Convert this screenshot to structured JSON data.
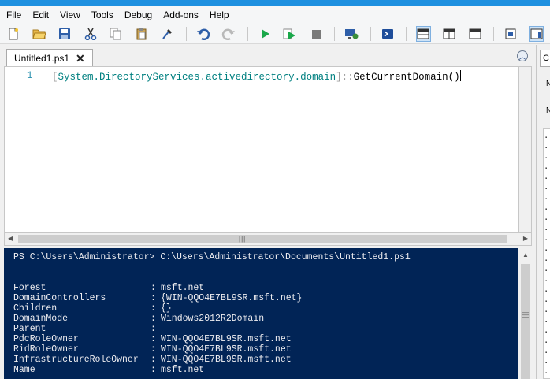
{
  "menu": [
    "File",
    "Edit",
    "View",
    "Tools",
    "Debug",
    "Add-ons",
    "Help"
  ],
  "toolbar_icons": [
    "new-file-icon",
    "open-folder-icon",
    "save-icon",
    "cut-icon",
    "copy-icon",
    "paste-icon",
    "clear-console-icon",
    "undo-icon",
    "redo-icon",
    "run-icon",
    "run-selection-icon",
    "stop-icon",
    "remote-powershell-icon",
    "powershell-console-icon",
    "show-script-top-icon",
    "show-script-right-icon",
    "show-script-maximized-icon",
    "show-command-window-icon",
    "show-command-addon-icon"
  ],
  "tab": {
    "label": "Untitled1.ps1",
    "close": "✕"
  },
  "editor": {
    "line_number": "1",
    "tokens": {
      "open_bracket": "[",
      "type_name": "System.DirectoryServices.activedirectory.domain",
      "close_bracket": "]",
      "operator": "::",
      "method": "GetCurrentDomain",
      "parens": "()"
    }
  },
  "console": {
    "prompt": "PS C:\\Users\\Administrator> C:\\Users\\Administrator\\Documents\\Untitled1.ps1",
    "properties": [
      {
        "name": "Forest",
        "value": "msft.net"
      },
      {
        "name": "DomainControllers",
        "value": "{WIN-QQO4E7BL9SR.msft.net}"
      },
      {
        "name": "Children",
        "value": "{}"
      },
      {
        "name": "DomainMode",
        "value": "Windows2012R2Domain"
      },
      {
        "name": "Parent",
        "value": ""
      },
      {
        "name": "PdcRoleOwner",
        "value": "WIN-QQO4E7BL9SR.msft.net"
      },
      {
        "name": "RidRoleOwner",
        "value": "WIN-QQO4E7BL9SR.msft.net"
      },
      {
        "name": "InfrastructureRoleOwner",
        "value": "WIN-QQO4E7BL9SR.msft.net"
      },
      {
        "name": "Name",
        "value": "msft.net"
      }
    ]
  },
  "right_panel": {
    "tab_letter": "C",
    "letters": [
      "N",
      "N"
    ]
  }
}
